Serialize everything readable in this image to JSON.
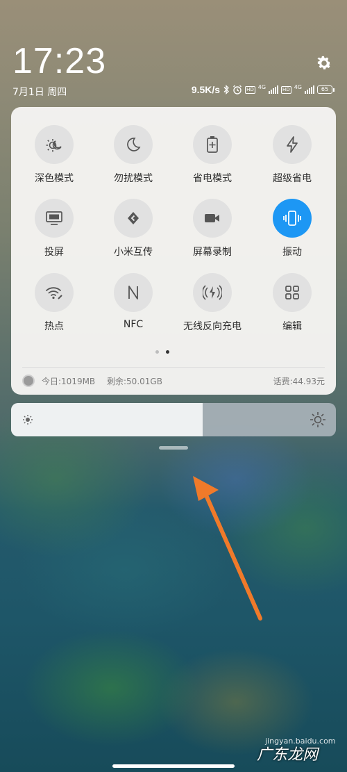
{
  "status_bar": {
    "time": "17:23",
    "date": "7月1日 周四",
    "net_speed": "9.5K/s",
    "battery": "65",
    "network_1": "4G",
    "network_2": "4G",
    "hd_badge": "HD"
  },
  "toggles": [
    {
      "label": "深色模式",
      "icon": "dark-mode-icon",
      "active": false
    },
    {
      "label": "勿扰模式",
      "icon": "moon-icon",
      "active": false
    },
    {
      "label": "省电模式",
      "icon": "battery-saver-icon",
      "active": false
    },
    {
      "label": "超级省电",
      "icon": "lightning-icon",
      "active": false
    },
    {
      "label": "投屏",
      "icon": "cast-screen-icon",
      "active": false
    },
    {
      "label": "小米互传",
      "icon": "mi-share-icon",
      "active": false
    },
    {
      "label": "屏幕录制",
      "icon": "video-camera-icon",
      "active": false
    },
    {
      "label": "振动",
      "icon": "vibrate-icon",
      "active": true
    },
    {
      "label": "热点",
      "icon": "hotspot-icon",
      "active": false
    },
    {
      "label": "NFC",
      "icon": "nfc-icon",
      "active": false
    },
    {
      "label": "无线反向充电",
      "icon": "reverse-charging-icon",
      "active": false
    },
    {
      "label": "编辑",
      "icon": "grid-edit-icon",
      "active": false
    }
  ],
  "pager": {
    "pages": 2,
    "current": 2
  },
  "usage": {
    "today": "今日:1019MB",
    "remaining": "剩余:50.01GB",
    "bill": "话费:44.93元"
  },
  "brightness": {
    "level": 0.59
  },
  "colors": {
    "accent": "#1d97f4",
    "arrow": "#f07a2a"
  },
  "watermark": {
    "text1": "jingyan.baidu.com",
    "text2": "广东龙网"
  }
}
